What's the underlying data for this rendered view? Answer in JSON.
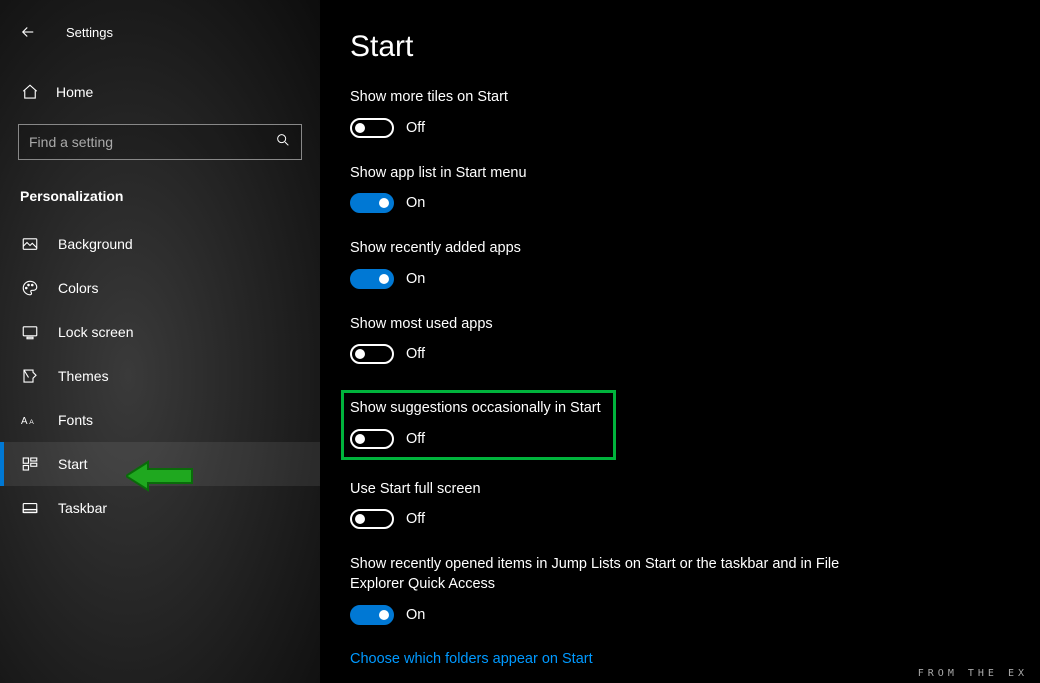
{
  "titlebar": {
    "app_title": "Settings"
  },
  "home": {
    "label": "Home"
  },
  "search": {
    "placeholder": "Find a setting"
  },
  "section": {
    "label": "Personalization"
  },
  "nav": [
    {
      "id": "background",
      "label": "Background"
    },
    {
      "id": "colors",
      "label": "Colors"
    },
    {
      "id": "lock-screen",
      "label": "Lock screen"
    },
    {
      "id": "themes",
      "label": "Themes"
    },
    {
      "id": "fonts",
      "label": "Fonts"
    },
    {
      "id": "start",
      "label": "Start"
    },
    {
      "id": "taskbar",
      "label": "Taskbar"
    }
  ],
  "page": {
    "title": "Start"
  },
  "settings": {
    "more_tiles": {
      "label": "Show more tiles on Start",
      "state": "Off",
      "on": false
    },
    "app_list": {
      "label": "Show app list in Start menu",
      "state": "On",
      "on": true
    },
    "recent_apps": {
      "label": "Show recently added apps",
      "state": "On",
      "on": true
    },
    "most_used": {
      "label": "Show most used apps",
      "state": "Off",
      "on": false
    },
    "suggestions": {
      "label": "Show suggestions occasionally in Start",
      "state": "Off",
      "on": false
    },
    "full_screen": {
      "label": "Use Start full screen",
      "state": "Off",
      "on": false
    },
    "jump_lists": {
      "label": "Show recently opened items in Jump Lists on Start or the taskbar and in File Explorer Quick Access",
      "state": "On",
      "on": true
    }
  },
  "link": {
    "folders": "Choose which folders appear on Start"
  },
  "watermark": "FROM THE EX"
}
